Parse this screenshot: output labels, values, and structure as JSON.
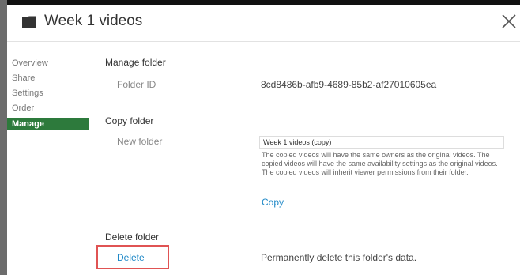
{
  "header": {
    "title": "Week 1 videos"
  },
  "nav": {
    "items": [
      "Overview",
      "Share",
      "Settings",
      "Order",
      "Manage"
    ]
  },
  "manage": {
    "section_title": "Manage folder",
    "folder_id_label": "Folder ID",
    "folder_id_value": "8cd8486b-afb9-4689-85b2-af27010605ea"
  },
  "copy": {
    "section_title": "Copy folder",
    "new_folder_label": "New folder",
    "new_folder_value": "Week 1 videos (copy)",
    "description": "The copied videos will have the same owners as the original videos. The copied videos will have the same availability settings as the original videos. The copied videos will inherit viewer permissions from their folder.",
    "copy_link": "Copy"
  },
  "delete": {
    "section_title": "Delete folder",
    "delete_link": "Delete",
    "description": "Permanently delete this folder's data."
  },
  "colors": {
    "active_nav": "#2d7a3c",
    "link": "#1e88c7",
    "highlight_box": "#e05353"
  }
}
